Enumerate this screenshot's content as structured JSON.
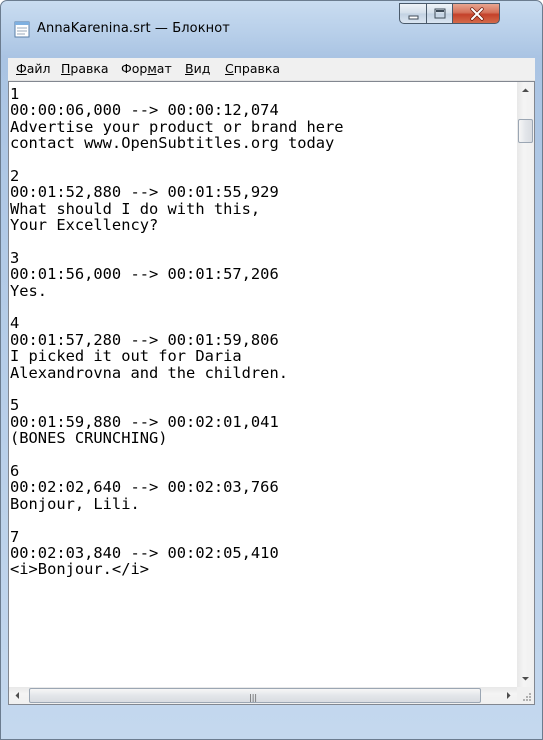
{
  "window": {
    "title": "AnnaKarenina.srt — Блокнот",
    "icon": "notepad-icon"
  },
  "menu": [
    {
      "accel": "Ф",
      "rest": "айл"
    },
    {
      "accel": "П",
      "rest": "равка"
    },
    {
      "pre": "Фор",
      "accel": "м",
      "rest": "ат"
    },
    {
      "accel": "В",
      "rest": "ид"
    },
    {
      "accel": "С",
      "rest": "правка"
    }
  ],
  "document": {
    "lines": [
      "1",
      "00:00:06,000 --> 00:00:12,074",
      "Advertise your product or brand here",
      "contact www.OpenSubtitles.org today",
      "",
      "2",
      "00:01:52,880 --> 00:01:55,929",
      "What should I do with this,",
      "Your Excellency?",
      "",
      "3",
      "00:01:56,000 --> 00:01:57,206",
      "Yes.",
      "",
      "4",
      "00:01:57,280 --> 00:01:59,806",
      "I picked it out for Daria",
      "Alexandrovna and the children.",
      "",
      "5",
      "00:01:59,880 --> 00:02:01,041",
      "(BONES CRUNCHING)",
      "",
      "6",
      "00:02:02,640 --> 00:02:03,766",
      "Bonjour, Lili.",
      "",
      "7",
      "00:02:03,840 --> 00:02:05,410",
      "<i>Bonjour.</i>"
    ]
  },
  "colors": {
    "close_button": "#c4412a",
    "frame": "#b9d0ea"
  }
}
